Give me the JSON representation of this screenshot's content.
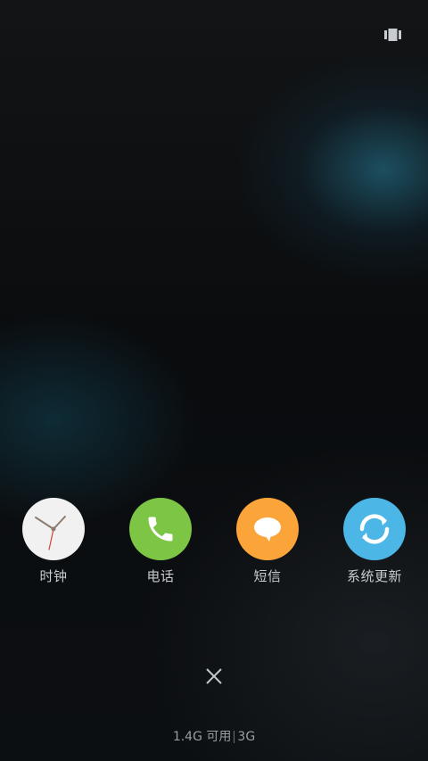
{
  "top_bar": {
    "multitask_icon": "multitask-grid-icon"
  },
  "recent_apps": [
    {
      "label": "时钟",
      "icon": "clock-icon",
      "color": "#f2f2f2"
    },
    {
      "label": "电话",
      "icon": "phone-icon",
      "color": "#7cc545"
    },
    {
      "label": "短信",
      "icon": "message-icon",
      "color": "#fba43a"
    },
    {
      "label": "系统更新",
      "icon": "refresh-icon",
      "color": "#4cb6e6"
    }
  ],
  "close_icon": "close-icon",
  "memory_status": {
    "available": "1.4G 可用",
    "total": "3G"
  }
}
